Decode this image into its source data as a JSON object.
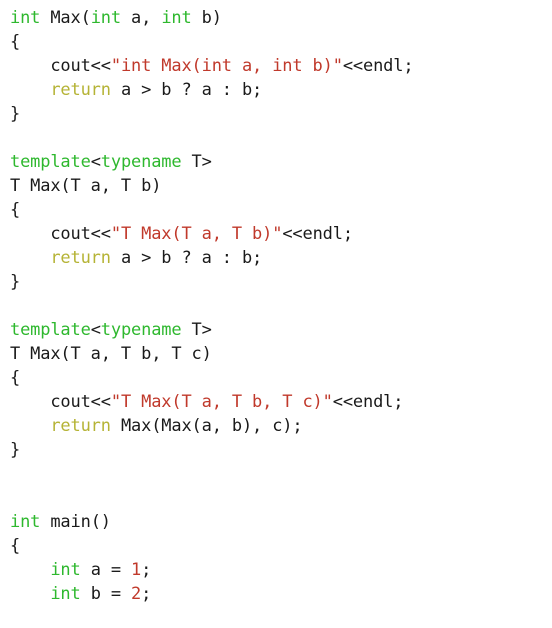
{
  "editor": {
    "background": "#ffffff",
    "language": "C++",
    "font_size_px": 17,
    "line_height_px": 24,
    "indent_spaces": 4
  },
  "theme": {
    "keyword": "#2eb82e",
    "string": "#c0392b",
    "number": "#c0392b",
    "return_keyword": "#b5b335",
    "plain_text": "#1a1a1a",
    "background": "#ffffff"
  },
  "lines": [
    {
      "id": 1,
      "tokens": [
        {
          "t": "int",
          "c": "kw"
        },
        {
          "t": " Max(",
          "c": "plain"
        },
        {
          "t": "int",
          "c": "kw"
        },
        {
          "t": " a, ",
          "c": "plain"
        },
        {
          "t": "int",
          "c": "kw"
        },
        {
          "t": " b)",
          "c": "plain"
        }
      ]
    },
    {
      "id": 2,
      "tokens": [
        {
          "t": "{",
          "c": "plain"
        }
      ]
    },
    {
      "id": 3,
      "tokens": [
        {
          "t": "    cout<<",
          "c": "plain"
        },
        {
          "t": "\"int Max(int a, int b)\"",
          "c": "str"
        },
        {
          "t": "<<endl;",
          "c": "plain"
        }
      ]
    },
    {
      "id": 4,
      "tokens": [
        {
          "t": "    ",
          "c": "plain"
        },
        {
          "t": "return",
          "c": "ret"
        },
        {
          "t": " a > b ? a : b;",
          "c": "plain"
        }
      ]
    },
    {
      "id": 5,
      "tokens": [
        {
          "t": "}",
          "c": "plain"
        }
      ]
    },
    {
      "id": 6,
      "tokens": []
    },
    {
      "id": 7,
      "tokens": [
        {
          "t": "template",
          "c": "kw"
        },
        {
          "t": "<",
          "c": "plain"
        },
        {
          "t": "typename",
          "c": "kw"
        },
        {
          "t": " T>",
          "c": "plain"
        }
      ]
    },
    {
      "id": 8,
      "tokens": [
        {
          "t": "T Max(T a, T b)",
          "c": "plain"
        }
      ]
    },
    {
      "id": 9,
      "tokens": [
        {
          "t": "{",
          "c": "plain"
        }
      ]
    },
    {
      "id": 10,
      "tokens": [
        {
          "t": "    cout<<",
          "c": "plain"
        },
        {
          "t": "\"T Max(T a, T b)\"",
          "c": "str"
        },
        {
          "t": "<<endl;",
          "c": "plain"
        }
      ]
    },
    {
      "id": 11,
      "tokens": [
        {
          "t": "    ",
          "c": "plain"
        },
        {
          "t": "return",
          "c": "ret"
        },
        {
          "t": " a > b ? a : b;",
          "c": "plain"
        }
      ]
    },
    {
      "id": 12,
      "tokens": [
        {
          "t": "}",
          "c": "plain"
        }
      ]
    },
    {
      "id": 13,
      "tokens": []
    },
    {
      "id": 14,
      "tokens": [
        {
          "t": "template",
          "c": "kw"
        },
        {
          "t": "<",
          "c": "plain"
        },
        {
          "t": "typename",
          "c": "kw"
        },
        {
          "t": " T>",
          "c": "plain"
        }
      ]
    },
    {
      "id": 15,
      "tokens": [
        {
          "t": "T Max(T a, T b, T c)",
          "c": "plain"
        }
      ]
    },
    {
      "id": 16,
      "tokens": [
        {
          "t": "{",
          "c": "plain"
        }
      ]
    },
    {
      "id": 17,
      "tokens": [
        {
          "t": "    cout<<",
          "c": "plain"
        },
        {
          "t": "\"T Max(T a, T b, T c)\"",
          "c": "str"
        },
        {
          "t": "<<endl;",
          "c": "plain"
        }
      ]
    },
    {
      "id": 18,
      "tokens": [
        {
          "t": "    ",
          "c": "plain"
        },
        {
          "t": "return",
          "c": "ret"
        },
        {
          "t": " Max(Max(a, b), c);",
          "c": "plain"
        }
      ]
    },
    {
      "id": 19,
      "tokens": [
        {
          "t": "}",
          "c": "plain"
        }
      ]
    },
    {
      "id": 20,
      "tokens": []
    },
    {
      "id": 21,
      "tokens": []
    },
    {
      "id": 22,
      "tokens": [
        {
          "t": "int",
          "c": "kw"
        },
        {
          "t": " main()",
          "c": "plain"
        }
      ]
    },
    {
      "id": 23,
      "tokens": [
        {
          "t": "{",
          "c": "plain"
        }
      ]
    },
    {
      "id": 24,
      "tokens": [
        {
          "t": "    ",
          "c": "plain"
        },
        {
          "t": "int",
          "c": "kw"
        },
        {
          "t": " a = ",
          "c": "plain"
        },
        {
          "t": "1",
          "c": "num"
        },
        {
          "t": ";",
          "c": "plain"
        }
      ]
    },
    {
      "id": 25,
      "tokens": [
        {
          "t": "    ",
          "c": "plain"
        },
        {
          "t": "int",
          "c": "kw"
        },
        {
          "t": " b = ",
          "c": "plain"
        },
        {
          "t": "2",
          "c": "num"
        },
        {
          "t": ";",
          "c": "plain"
        }
      ]
    }
  ]
}
